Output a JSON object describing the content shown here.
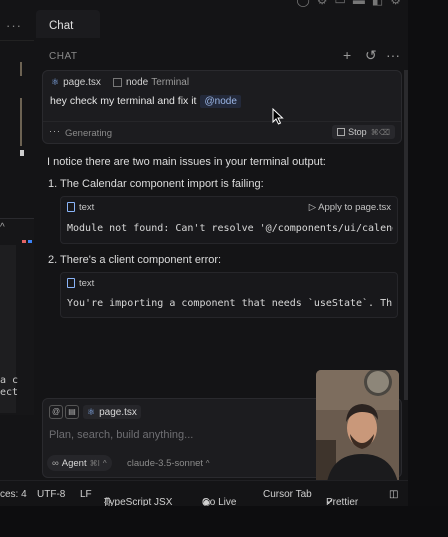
{
  "left_panel": {
    "menu": "···",
    "terminal_text": "a c\nect"
  },
  "tab": {
    "label": "Chat"
  },
  "chat_header": {
    "label": "CHAT"
  },
  "user_message": {
    "context_chips": [
      {
        "label": "page.tsx",
        "icon": "react-icon"
      },
      {
        "label": "node",
        "sub": "Terminal",
        "icon": "terminal-icon"
      }
    ],
    "text": "hey check my terminal and fix it",
    "mention": "@node",
    "status": "Generating",
    "stop_label": "Stop",
    "stop_shortcut": "⌘⌫"
  },
  "response": {
    "intro": "I notice there are two main issues in your terminal output:",
    "items": [
      {
        "heading": "1. The Calendar component import is failing:",
        "block_lang": "text",
        "apply_label": "Apply to page.tsx",
        "code": "Module not found: Can't resolve '@/components/ui/calendar'"
      },
      {
        "heading": "2. There's a client component error:",
        "block_lang": "text",
        "code": "You're importing a component that needs `useState`. This only works in a Client Component"
      }
    ]
  },
  "composer": {
    "chip": "page.tsx",
    "placeholder": "Plan, search, build anything...",
    "agent_label": "Agent",
    "agent_shortcut": "⌘I",
    "model": "claude-3.5-sonnet"
  },
  "status_bar": {
    "spaces": "ces: 4",
    "encoding": "UTF-8",
    "eol": "LF",
    "language": "TypeScript JSX",
    "go_live": "Go Live",
    "cursor_tab": "Cursor Tab",
    "prettier": "Prettier"
  }
}
